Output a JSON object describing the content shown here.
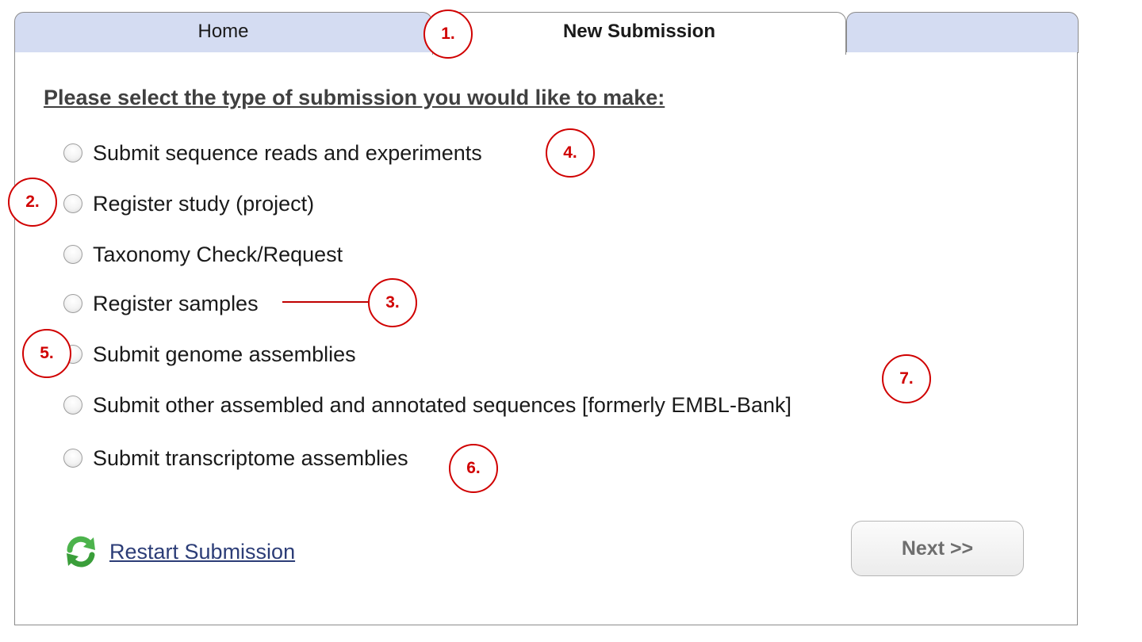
{
  "tabs": {
    "home": "Home",
    "new_submission": "New Submission",
    "blank": ""
  },
  "heading": "Please select the type of submission you would like to make:",
  "options": [
    "Submit sequence reads and experiments",
    "Register study (project)",
    "Taxonomy Check/Request",
    "Register samples",
    "Submit genome assemblies",
    "Submit other assembled and annotated sequences [formerly EMBL-Bank]",
    "Submit transcriptome assemblies"
  ],
  "footer": {
    "restart_label": "Restart Submission",
    "next_label": "Next >>"
  },
  "annotations": [
    "1.",
    "2.",
    "3.",
    "4.",
    "5.",
    "6.",
    "7."
  ],
  "colors": {
    "tab_inactive": "#d4dcf2",
    "link": "#2c3d77",
    "annotation": "#d00000",
    "refresh_green": "#3fae3f"
  },
  "icons": {
    "restart": "refresh-icon",
    "option": "radio-button"
  }
}
